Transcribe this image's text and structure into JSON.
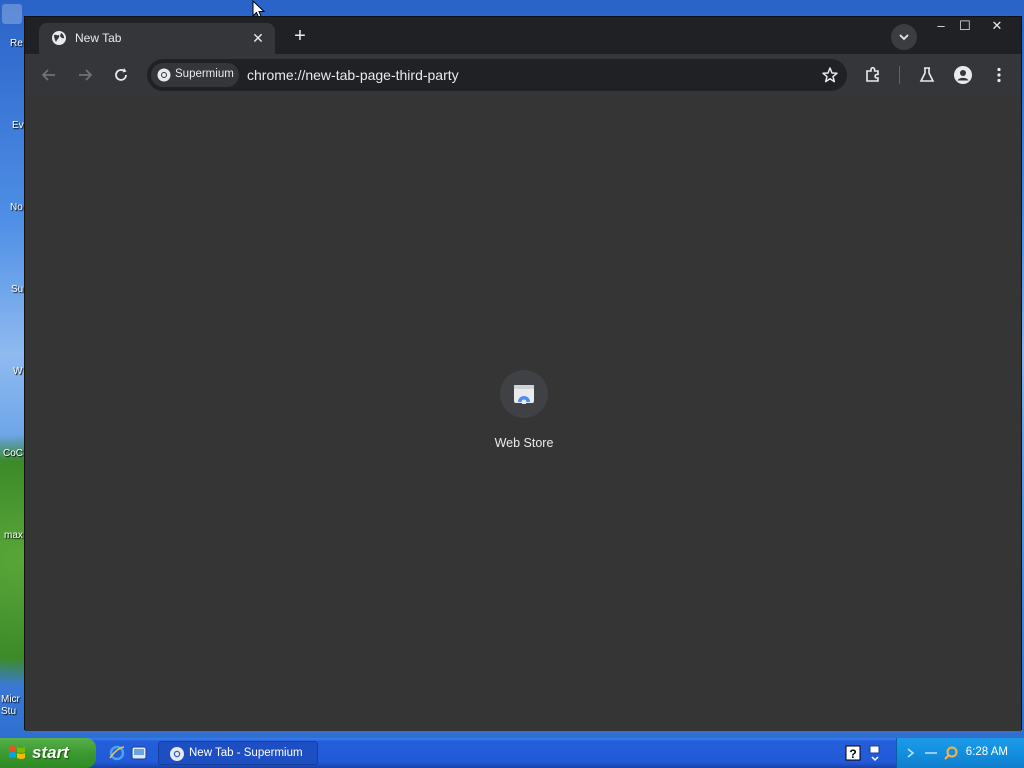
{
  "desktop": {
    "icons": [
      {
        "label": "Re"
      },
      {
        "label": "Ev"
      },
      {
        "label": "No"
      },
      {
        "label": "Su"
      },
      {
        "label": "W"
      },
      {
        "label": "CoC"
      },
      {
        "label": "max"
      },
      {
        "label": "Micr Stu"
      }
    ]
  },
  "browser": {
    "tab": {
      "title": "New Tab",
      "close_glyph": "✕"
    },
    "new_tab_glyph": "+",
    "window_controls": {
      "minimize": "–",
      "maximize": "☐",
      "close": "✕"
    },
    "omnibox": {
      "site_chip": "Supermium",
      "url": "chrome://new-tab-page-third-party"
    },
    "shortcuts": [
      {
        "label": "Web Store",
        "icon": "web-store-icon"
      }
    ],
    "colors": {
      "frame": "#202124",
      "toolbar": "#35363a",
      "content": "#353535",
      "text": "#e8eaed"
    }
  },
  "taskbar": {
    "start_label": "start",
    "task_button": "New Tab - Supermium",
    "clock": "6:28 AM"
  }
}
